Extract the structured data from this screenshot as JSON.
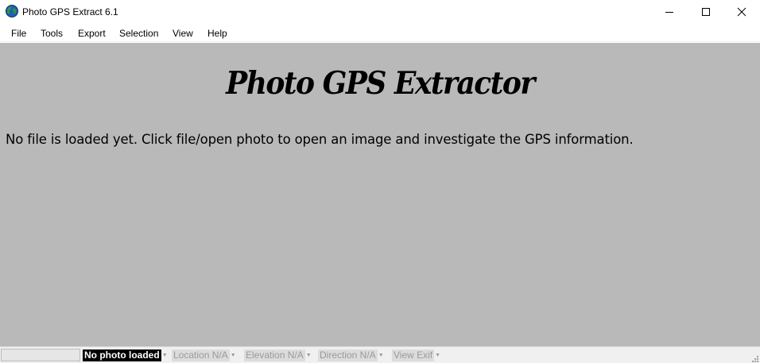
{
  "window": {
    "title": "Photo GPS Extract 6.1",
    "app_icon": "globe-icon",
    "controls": [
      "minimize-icon",
      "maximize-icon",
      "close-icon"
    ]
  },
  "menu": {
    "items": [
      {
        "label": "File"
      },
      {
        "label": "Tools"
      },
      {
        "label": "Export"
      },
      {
        "label": "Selection"
      },
      {
        "label": "View"
      },
      {
        "label": "Help"
      }
    ]
  },
  "content": {
    "heading": "Photo GPS Extractor",
    "message": "No file is loaded yet. Click file/open photo to open an image and investigate the GPS information.",
    "background_color": "#b9b9b9"
  },
  "statusbar": {
    "photo_status": "No photo loaded",
    "location": "Location N/A",
    "elevation": "Elevation N/A",
    "direction": "Direction N/A",
    "view_exif": "View Exif"
  }
}
